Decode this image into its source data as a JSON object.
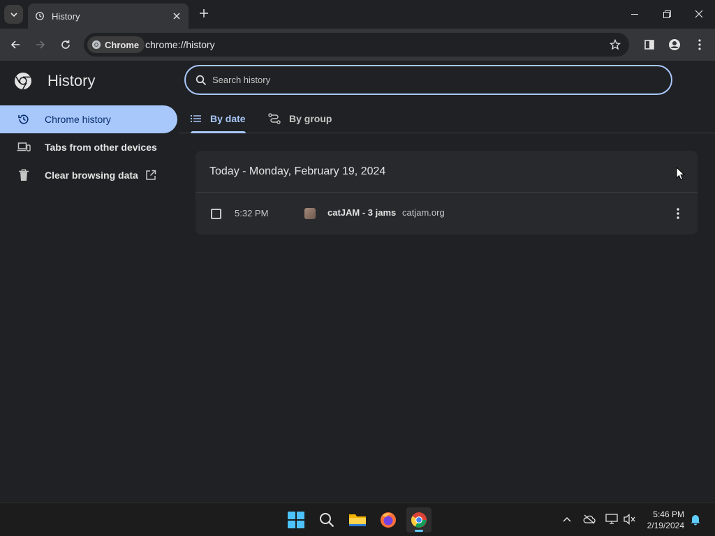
{
  "browser": {
    "tab_title": "History",
    "chip_label": "Chrome",
    "url": "chrome://history"
  },
  "page": {
    "title": "History",
    "search_placeholder": "Search history"
  },
  "sidebar": {
    "items": [
      {
        "label": "Chrome history",
        "icon": "history-icon",
        "active": true
      },
      {
        "label": "Tabs from other devices",
        "icon": "devices-icon"
      },
      {
        "label": "Clear browsing data",
        "icon": "trash-icon"
      }
    ]
  },
  "tabs": [
    {
      "label": "By date",
      "icon": "list-icon",
      "active": true
    },
    {
      "label": "By group",
      "icon": "group-icon"
    }
  ],
  "history": {
    "date_header": "Today - Monday, February 19, 2024",
    "entries": [
      {
        "time": "5:32 PM",
        "title": "catJAM - 3 jams",
        "domain": "catjam.org"
      }
    ]
  },
  "taskbar": {
    "time": "5:46 PM",
    "date": "2/19/2024"
  },
  "colors": {
    "accent": "#a8c7fa",
    "background": "#202124",
    "toolbar": "#35363a"
  }
}
